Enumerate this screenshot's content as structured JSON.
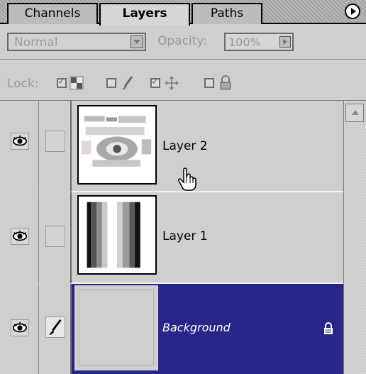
{
  "tabs": [
    {
      "label": "Channels",
      "active": false
    },
    {
      "label": "Layers",
      "active": true
    },
    {
      "label": "Paths",
      "active": false
    }
  ],
  "blend": {
    "mode": "Normal",
    "opacity_label": "Opacity:",
    "opacity_value": "100%"
  },
  "lock": {
    "label": "Lock:",
    "transparency_checked": true,
    "image_checked": false,
    "position_checked": true,
    "all_checked": false
  },
  "layers": [
    {
      "name": "Layer 2",
      "visible": true,
      "selected": false
    },
    {
      "name": "Layer 1",
      "visible": true,
      "selected": false
    },
    {
      "name": "Background",
      "visible": true,
      "selected": true,
      "locked": true
    }
  ],
  "colors": {
    "selection": "#27278a",
    "panel": "#cfcfcf"
  },
  "icons": {
    "visibility": "eye-icon",
    "brush": "brush-icon",
    "lock": "lock-icon",
    "menu": "panel-menu-icon"
  }
}
